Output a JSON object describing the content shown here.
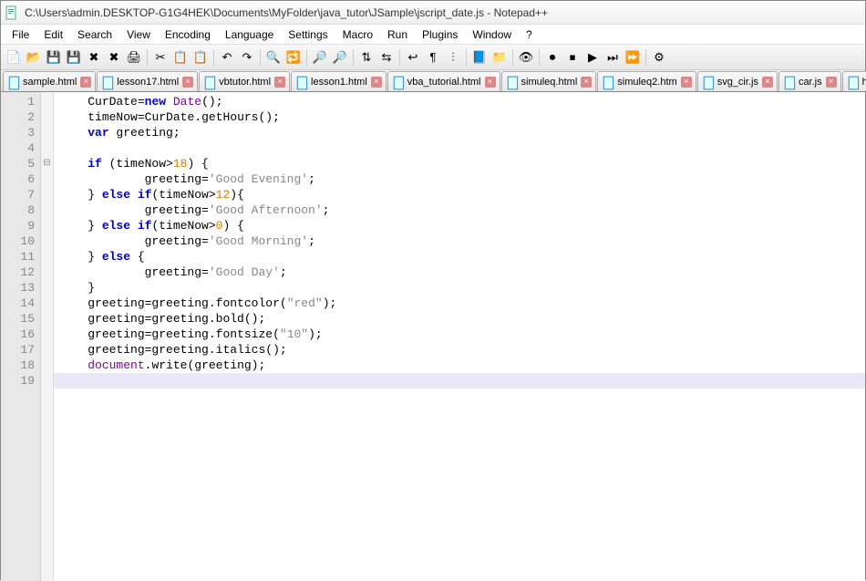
{
  "titlebar": {
    "path": "C:\\Users\\admin.DESKTOP-G1G4HEK\\Documents\\MyFolder\\java_tutor\\JSample\\jscript_date.js - Notepad++"
  },
  "menu": {
    "items": [
      "File",
      "Edit",
      "Search",
      "View",
      "Encoding",
      "Language",
      "Settings",
      "Macro",
      "Run",
      "Plugins",
      "Window",
      "?"
    ]
  },
  "toolbar": {
    "buttons": [
      {
        "name": "new-file-icon",
        "glyph": "📄"
      },
      {
        "name": "open-file-icon",
        "glyph": "📂"
      },
      {
        "name": "save-icon",
        "glyph": "💾"
      },
      {
        "name": "save-all-icon",
        "glyph": "💾"
      },
      {
        "name": "close-icon",
        "glyph": "✖"
      },
      {
        "name": "close-all-icon",
        "glyph": "✖"
      },
      {
        "name": "print-icon",
        "glyph": "🖨"
      },
      {
        "sep": true
      },
      {
        "name": "cut-icon",
        "glyph": "✂"
      },
      {
        "name": "copy-icon",
        "glyph": "📋"
      },
      {
        "name": "paste-icon",
        "glyph": "📋"
      },
      {
        "sep": true
      },
      {
        "name": "undo-icon",
        "glyph": "↶"
      },
      {
        "name": "redo-icon",
        "glyph": "↷"
      },
      {
        "sep": true
      },
      {
        "name": "find-icon",
        "glyph": "🔍"
      },
      {
        "name": "replace-icon",
        "glyph": "🔁"
      },
      {
        "sep": true
      },
      {
        "name": "zoom-in-icon",
        "glyph": "🔎"
      },
      {
        "name": "zoom-out-icon",
        "glyph": "🔎"
      },
      {
        "sep": true
      },
      {
        "name": "sync-v-icon",
        "glyph": "⇅"
      },
      {
        "name": "sync-h-icon",
        "glyph": "⇆"
      },
      {
        "sep": true
      },
      {
        "name": "wordwrap-icon",
        "glyph": "↩"
      },
      {
        "name": "all-chars-icon",
        "glyph": "¶"
      },
      {
        "name": "indent-guide-icon",
        "glyph": "⫶"
      },
      {
        "sep": true
      },
      {
        "name": "lang-icon",
        "glyph": "📘"
      },
      {
        "name": "folder-icon",
        "glyph": "📁"
      },
      {
        "sep": true
      },
      {
        "name": "monitor-icon",
        "glyph": "👁"
      },
      {
        "sep": true
      },
      {
        "name": "record-icon",
        "glyph": "⏺"
      },
      {
        "name": "stop-icon",
        "glyph": "⏹"
      },
      {
        "name": "play-icon",
        "glyph": "▶"
      },
      {
        "name": "play-multi-icon",
        "glyph": "⏭"
      },
      {
        "name": "save-macro-icon",
        "glyph": "⏩"
      },
      {
        "sep": true
      },
      {
        "name": "settings-icon",
        "glyph": "⚙"
      }
    ]
  },
  "tabs": [
    {
      "label": "sample.html"
    },
    {
      "label": "lesson17.html"
    },
    {
      "label": "vbtutor.html"
    },
    {
      "label": "lesson1.html"
    },
    {
      "label": "vba_tutorial.html"
    },
    {
      "label": "simuleq.html"
    },
    {
      "label": "simuleq2.htm"
    },
    {
      "label": "svg_cir.js"
    },
    {
      "label": "car.js"
    },
    {
      "label": "hotel.html"
    }
  ],
  "code": {
    "current_line": 19,
    "lines": [
      {
        "n": 1,
        "tokens": [
          {
            "t": "CurDate",
            "c": "ident"
          },
          {
            "t": "=",
            "c": "op"
          },
          {
            "t": "new",
            "c": "kw"
          },
          {
            "t": " "
          },
          {
            "t": "Date",
            "c": "kw2"
          },
          {
            "t": "();",
            "c": "paren"
          }
        ],
        "indent": 0
      },
      {
        "n": 2,
        "tokens": [
          {
            "t": "timeNow",
            "c": "ident"
          },
          {
            "t": "=",
            "c": "op"
          },
          {
            "t": "CurDate",
            "c": "ident"
          },
          {
            "t": ".",
            "c": "op"
          },
          {
            "t": "getHours",
            "c": "fn"
          },
          {
            "t": "();",
            "c": "paren"
          }
        ],
        "indent": 0
      },
      {
        "n": 3,
        "tokens": [
          {
            "t": "var",
            "c": "kw"
          },
          {
            "t": " greeting;",
            "c": "ident"
          }
        ],
        "indent": 0
      },
      {
        "n": 4,
        "tokens": [],
        "indent": 0
      },
      {
        "n": 5,
        "fold": "-",
        "tokens": [
          {
            "t": "if",
            "c": "kw"
          },
          {
            "t": " (timeNow>",
            "c": "ident"
          },
          {
            "t": "18",
            "c": "num"
          },
          {
            "t": ") {",
            "c": "paren"
          }
        ],
        "indent": 0
      },
      {
        "n": 6,
        "tokens": [
          {
            "t": "greeting=",
            "c": "ident"
          },
          {
            "t": "'Good Evening'",
            "c": "str"
          },
          {
            "t": ";",
            "c": "op"
          }
        ],
        "indent": 2
      },
      {
        "n": 7,
        "tokens": [
          {
            "t": "} ",
            "c": "paren"
          },
          {
            "t": "else if",
            "c": "kw"
          },
          {
            "t": "(timeNow>",
            "c": "ident"
          },
          {
            "t": "12",
            "c": "num"
          },
          {
            "t": "){",
            "c": "paren"
          }
        ],
        "indent": 0
      },
      {
        "n": 8,
        "tokens": [
          {
            "t": "greeting=",
            "c": "ident"
          },
          {
            "t": "'Good Afternoon'",
            "c": "str"
          },
          {
            "t": ";",
            "c": "op"
          }
        ],
        "indent": 2
      },
      {
        "n": 9,
        "tokens": [
          {
            "t": "} ",
            "c": "paren"
          },
          {
            "t": "else if",
            "c": "kw"
          },
          {
            "t": "(timeNow>",
            "c": "ident"
          },
          {
            "t": "0",
            "c": "num"
          },
          {
            "t": ") {",
            "c": "paren"
          }
        ],
        "indent": 0
      },
      {
        "n": 10,
        "tokens": [
          {
            "t": "greeting=",
            "c": "ident"
          },
          {
            "t": "'Good Morning'",
            "c": "str"
          },
          {
            "t": ";",
            "c": "op"
          }
        ],
        "indent": 2
      },
      {
        "n": 11,
        "tokens": [
          {
            "t": "} ",
            "c": "paren"
          },
          {
            "t": "else",
            "c": "kw"
          },
          {
            "t": " {",
            "c": "paren"
          }
        ],
        "indent": 0
      },
      {
        "n": 12,
        "tokens": [
          {
            "t": "greeting=",
            "c": "ident"
          },
          {
            "t": "'Good Day'",
            "c": "str"
          },
          {
            "t": ";",
            "c": "op"
          }
        ],
        "indent": 2
      },
      {
        "n": 13,
        "tokens": [
          {
            "t": "}",
            "c": "paren"
          }
        ],
        "indent": 0
      },
      {
        "n": 14,
        "tokens": [
          {
            "t": "greeting=greeting.",
            "c": "ident"
          },
          {
            "t": "fontcolor",
            "c": "fn"
          },
          {
            "t": "(",
            "c": "paren"
          },
          {
            "t": "\"red\"",
            "c": "str"
          },
          {
            "t": ");",
            "c": "paren"
          }
        ],
        "indent": 0
      },
      {
        "n": 15,
        "tokens": [
          {
            "t": "greeting=greeting.",
            "c": "ident"
          },
          {
            "t": "bold",
            "c": "fn"
          },
          {
            "t": "();",
            "c": "paren"
          }
        ],
        "indent": 0
      },
      {
        "n": 16,
        "tokens": [
          {
            "t": "greeting=greeting.",
            "c": "ident"
          },
          {
            "t": "fontsize",
            "c": "fn"
          },
          {
            "t": "(",
            "c": "paren"
          },
          {
            "t": "\"10\"",
            "c": "str"
          },
          {
            "t": ");",
            "c": "paren"
          }
        ],
        "indent": 0
      },
      {
        "n": 17,
        "tokens": [
          {
            "t": "greeting=greeting.",
            "c": "ident"
          },
          {
            "t": "italics",
            "c": "fn"
          },
          {
            "t": "();",
            "c": "paren"
          }
        ],
        "indent": 0
      },
      {
        "n": 18,
        "tokens": [
          {
            "t": "document",
            "c": "kw2"
          },
          {
            "t": ".",
            "c": "op"
          },
          {
            "t": "write",
            "c": "fn"
          },
          {
            "t": "(greeting);",
            "c": "paren"
          }
        ],
        "indent": 0
      },
      {
        "n": 19,
        "tokens": [],
        "indent": 0
      }
    ]
  }
}
